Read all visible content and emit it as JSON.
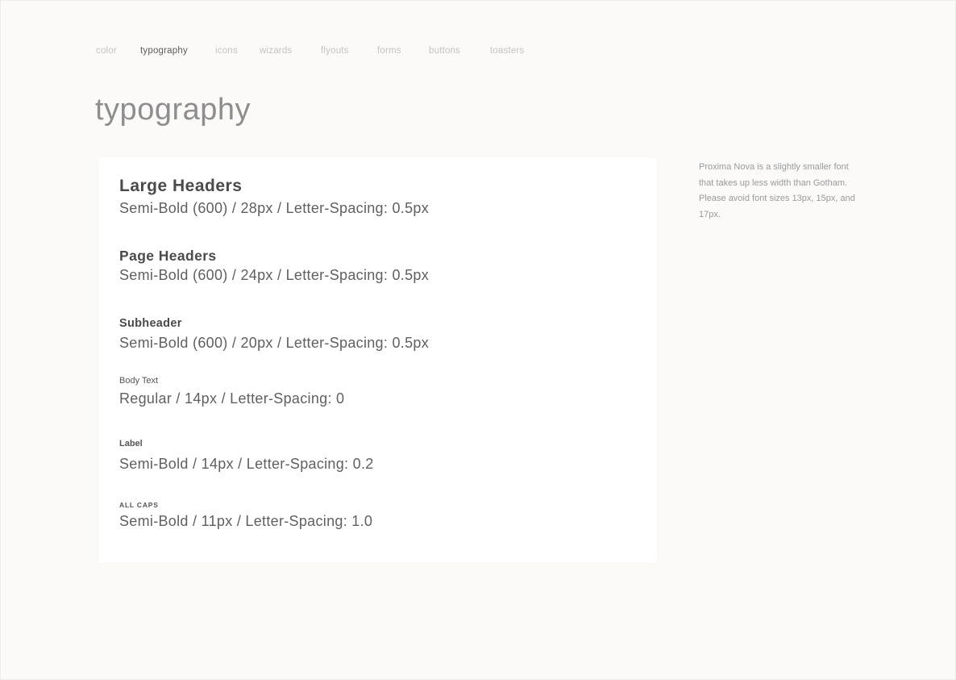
{
  "nav": {
    "items": [
      {
        "label": "color",
        "active": false
      },
      {
        "label": "typography",
        "active": true
      },
      {
        "label": "icons",
        "active": false
      },
      {
        "label": "wizards",
        "active": false
      },
      {
        "label": "flyouts",
        "active": false
      },
      {
        "label": "forms",
        "active": false
      },
      {
        "label": "buttons",
        "active": false
      },
      {
        "label": "toasters",
        "active": false
      }
    ]
  },
  "page": {
    "title": "typography"
  },
  "specs": {
    "large": {
      "name": "Large Headers",
      "desc": "Semi-Bold (600) / 28px / Letter-Spacing: 0.5px"
    },
    "page": {
      "name": "Page Headers",
      "desc": "Semi-Bold (600) / 24px / Letter-Spacing: 0.5px"
    },
    "sub": {
      "name": "Subheader",
      "desc": "Semi-Bold (600) / 20px / Letter-Spacing: 0.5px"
    },
    "body": {
      "name": "Body Text",
      "desc": "Regular / 14px / Letter-Spacing: 0"
    },
    "label": {
      "name": "Label",
      "desc": "Semi-Bold / 14px / Letter-Spacing: 0.2"
    },
    "caps": {
      "name": "ALL CAPS",
      "desc": "Semi-Bold / 11px / Letter-Spacing: 1.0"
    }
  },
  "note": {
    "text": "Proxima Nova is a slightly smaller font that takes up less width than Gotham. Please avoid font sizes 13px, 15px, and 17px."
  },
  "colors": {
    "background": "#fbfaf9",
    "card": "#ffffff",
    "nav_inactive": "#c3c3c1",
    "nav_active": "#5d5d5d",
    "title": "#8e8e8e",
    "text": "#4a4a4a",
    "note": "#9a9a9a"
  }
}
